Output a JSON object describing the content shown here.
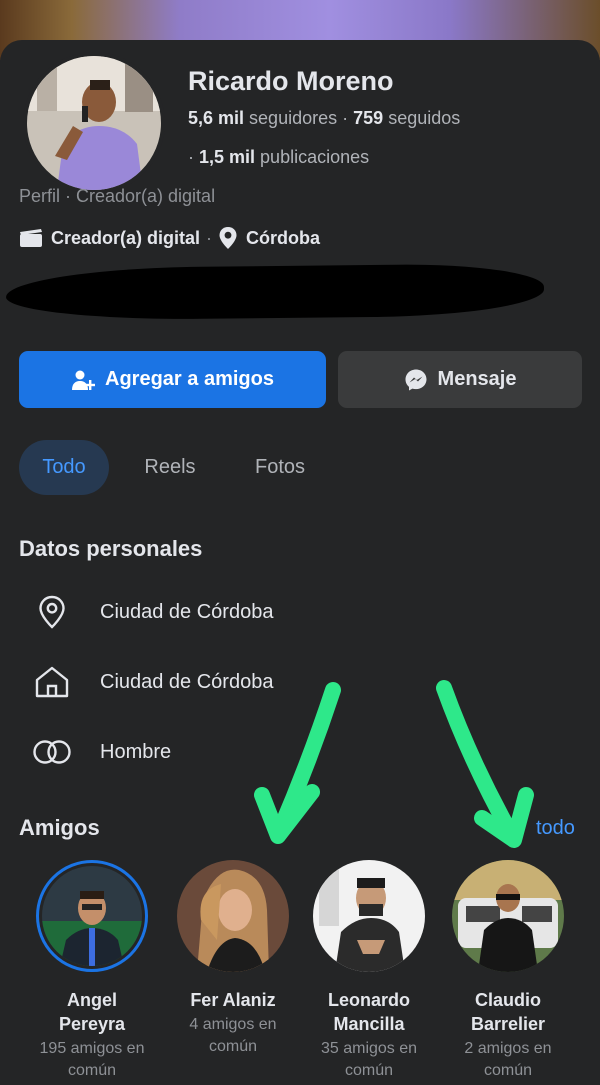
{
  "profile": {
    "name": "Ricardo Moreno",
    "followers_count": "5,6 mil",
    "followers_label": "seguidores",
    "following_count": "759",
    "following_label": "seguidos",
    "posts_count": "1,5 mil",
    "posts_label": "publicaciones",
    "category_line": "Perfil · Creador(a) digital",
    "creator_label": "Creador(a) digital",
    "location": "Córdoba"
  },
  "actions": {
    "add_friend": "Agregar a amigos",
    "message": "Mensaje"
  },
  "tabs": [
    {
      "label": "Todo",
      "active": true
    },
    {
      "label": "Reels",
      "active": false
    },
    {
      "label": "Fotos",
      "active": false
    }
  ],
  "personal": {
    "title": "Datos personales",
    "items": [
      {
        "icon": "location-pin-icon",
        "text": "Ciudad de Córdoba"
      },
      {
        "icon": "home-icon",
        "text": "Ciudad de Córdoba"
      },
      {
        "icon": "gender-icon",
        "text": "Hombre"
      }
    ]
  },
  "friends": {
    "title": "Amigos",
    "see_all": "todo",
    "items": [
      {
        "name_line1": "Angel",
        "name_line2": "Pereyra",
        "mutual_line1": "195 amigos en",
        "mutual_line2": "común"
      },
      {
        "name_line1": "Fer Alaniz",
        "name_line2": "",
        "mutual_line1": "4 amigos en",
        "mutual_line2": "común"
      },
      {
        "name_line1": "Leonardo",
        "name_line2": "Mancilla",
        "mutual_line1": "35 amigos en",
        "mutual_line2": "común"
      },
      {
        "name_line1": "Claudio",
        "name_line2": "Barrelier",
        "mutual_line1": "2 amigos en",
        "mutual_line2": "común"
      }
    ]
  },
  "colors": {
    "background": "#242526",
    "primary": "#1b74e4",
    "link": "#4599ff",
    "annotation_arrow": "#2ee88a"
  }
}
